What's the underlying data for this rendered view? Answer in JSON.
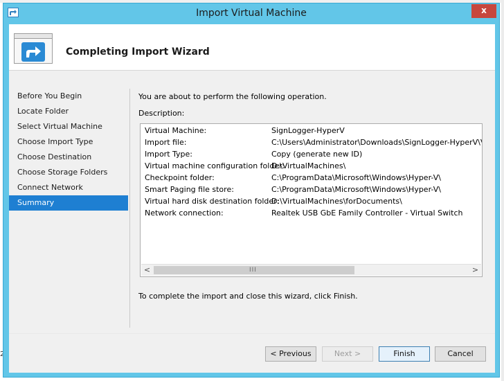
{
  "window": {
    "title": "Import Virtual Machine",
    "close_label": "x"
  },
  "header": {
    "title": "Completing Import Wizard"
  },
  "nav": {
    "items": [
      {
        "label": "Before You Begin"
      },
      {
        "label": "Locate Folder"
      },
      {
        "label": "Select Virtual Machine"
      },
      {
        "label": "Choose Import Type"
      },
      {
        "label": "Choose Destination"
      },
      {
        "label": "Choose Storage Folders"
      },
      {
        "label": "Connect Network"
      },
      {
        "label": "Summary"
      }
    ],
    "active_index": 7
  },
  "content": {
    "intro": "You are about to perform the following operation.",
    "description_label": "Description:",
    "rows": [
      {
        "key": "Virtual Machine:",
        "value": "SignLogger-HyperV"
      },
      {
        "key": "Import file:",
        "value": "C:\\Users\\Administrator\\Downloads\\SignLogger-HyperV\\Virtual M"
      },
      {
        "key": "Import Type:",
        "value": "Copy (generate new ID)"
      },
      {
        "key": "Virtual machine configuration folder:",
        "value": "D:\\VirtualMachines\\"
      },
      {
        "key": "Checkpoint folder:",
        "value": "C:\\ProgramData\\Microsoft\\Windows\\Hyper-V\\"
      },
      {
        "key": "Smart Paging file store:",
        "value": "C:\\ProgramData\\Microsoft\\Windows\\Hyper-V\\"
      },
      {
        "key": "Virtual hard disk destination folder:",
        "value": "D:\\VirtualMachines\\forDocuments\\"
      },
      {
        "key": "Network connection:",
        "value": "Realtek USB GbE Family Controller - Virtual Switch"
      }
    ],
    "scroll_left": "<",
    "scroll_right": ">",
    "scroll_grip": "III",
    "finish_note": "To complete the import and close this wizard, click Finish."
  },
  "buttons": {
    "previous": "< Previous",
    "next": "Next >",
    "finish": "Finish",
    "cancel": "Cancel"
  },
  "background": {
    "edge_char": "2"
  },
  "colors": {
    "titlebar": "#62c6e8",
    "close": "#c7473d",
    "nav_active": "#1e7fd2"
  }
}
